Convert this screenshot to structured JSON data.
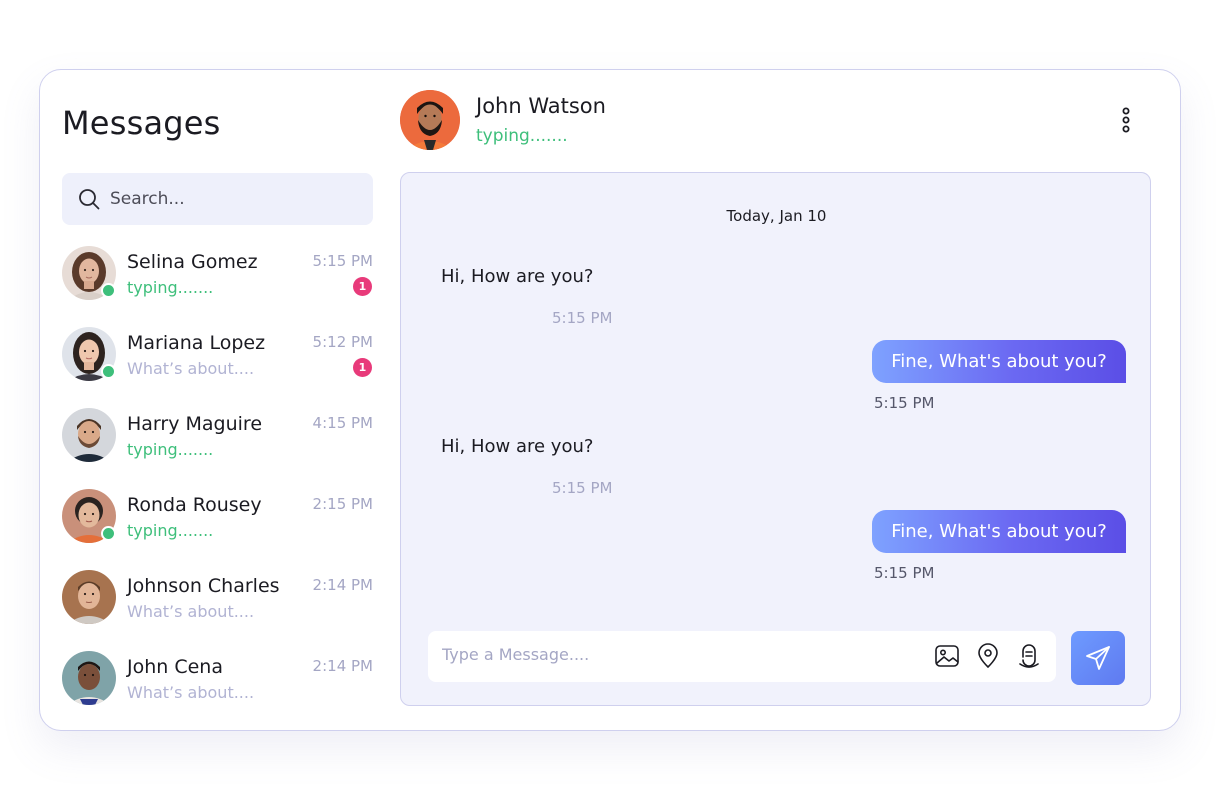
{
  "sidebar": {
    "title": "Messages",
    "search_placeholder": "Search...",
    "contacts": [
      {
        "name": "Selina Gomez",
        "status": "typing.......",
        "time": "5:15 PM",
        "unread": "1",
        "online": true,
        "avatar": "woman-curly-hair-avatar"
      },
      {
        "name": "Mariana Lopez",
        "status": "What’s about....",
        "time": "5:12 PM",
        "unread": "1",
        "online": true,
        "avatar": "woman-dark-hair-avatar"
      },
      {
        "name": "Harry Maguire",
        "status": "typing.......",
        "time": "4:15 PM",
        "unread": "",
        "online": false,
        "avatar": "man-beard-avatar"
      },
      {
        "name": "Ronda Rousey",
        "status": "typing.......",
        "time": "2:15 PM",
        "unread": "",
        "online": true,
        "avatar": "woman-short-hair-avatar"
      },
      {
        "name": "Johnson Charles",
        "status": "What’s about....",
        "time": "2:14 PM",
        "unread": "",
        "online": false,
        "avatar": "man-casual-avatar"
      },
      {
        "name": "John Cena",
        "status": "What’s about....",
        "time": "2:14 PM",
        "unread": "",
        "online": false,
        "avatar": "man-dark-skin-avatar"
      }
    ]
  },
  "chat": {
    "contact_name": "John Watson",
    "contact_status": "typing.......",
    "date_label": "Today, Jan 10",
    "messages": [
      {
        "direction": "in",
        "text": "Hi, How are you?",
        "time": "5:15 PM"
      },
      {
        "direction": "out",
        "text": "Fine, What's about you?",
        "time": "5:15 PM"
      },
      {
        "direction": "in",
        "text": "Hi, How are you?",
        "time": "5:15 PM"
      },
      {
        "direction": "out",
        "text": "Fine, What's about you?",
        "time": "5:15 PM"
      }
    ],
    "composer_placeholder": "Type a Message...."
  },
  "colors": {
    "accent_green": "#3ebf7b",
    "badge_pink": "#e83a7a",
    "bubble_gradient_start": "#7ea2ff",
    "bubble_gradient_end": "#5b4ee6",
    "panel_bg": "#f1f2fc"
  },
  "icons": {
    "search": "search-icon",
    "more": "more-vertical-icon",
    "image": "image-icon",
    "location": "location-pin-icon",
    "attach": "paperclip-icon",
    "send": "send-icon"
  }
}
